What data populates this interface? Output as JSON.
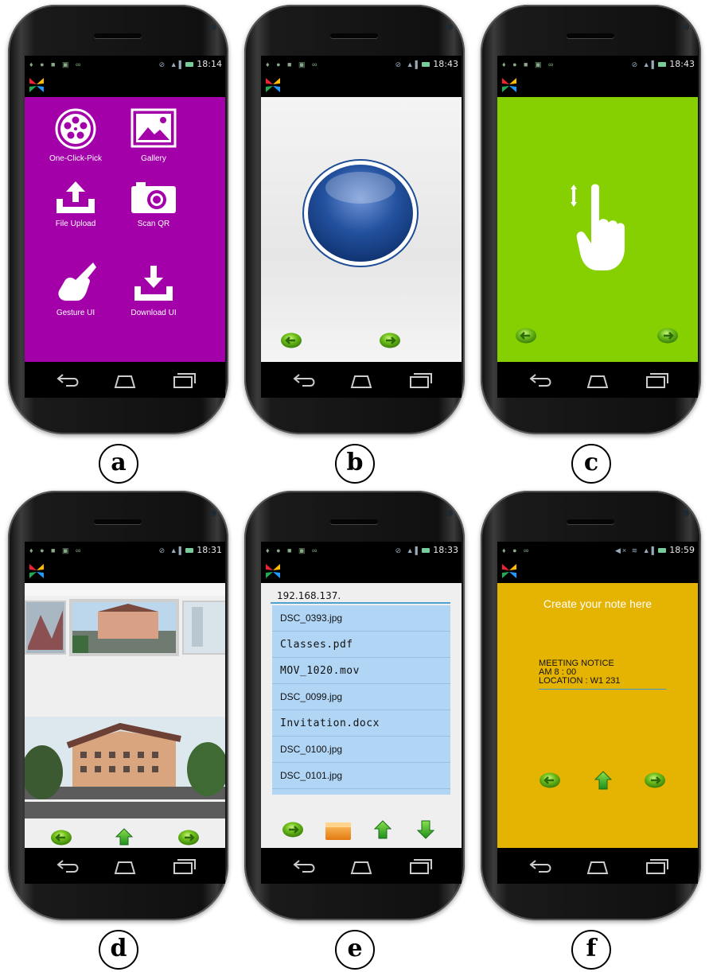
{
  "panels": {
    "a": {
      "label": "a",
      "time": "18:14",
      "tiles": [
        "One-Click-Pick",
        "Gallery",
        "File Upload",
        "Scan QR",
        "Gesture UI",
        "Download UI"
      ],
      "color": "#a300aa"
    },
    "b": {
      "label": "b",
      "time": "18:43"
    },
    "c": {
      "label": "c",
      "time": "18:43",
      "color": "#86cf00"
    },
    "d": {
      "label": "d",
      "time": "18:31"
    },
    "e": {
      "label": "e",
      "time": "18:33",
      "ip_value": "192.168.137.",
      "files": [
        "DSC_0393.jpg",
        "Classes.pdf",
        "MOV_1020.mov",
        "DSC_0099.jpg",
        "Invitation.docx",
        "DSC_0100.jpg",
        "DSC_0101.jpg"
      ]
    },
    "f": {
      "label": "f",
      "time": "18:59",
      "title": "Create your note here",
      "note_lines": [
        "MEETING NOTICE",
        "AM 8 : 00",
        "LOCATION : W1 231"
      ],
      "color": "#e5b403"
    }
  }
}
